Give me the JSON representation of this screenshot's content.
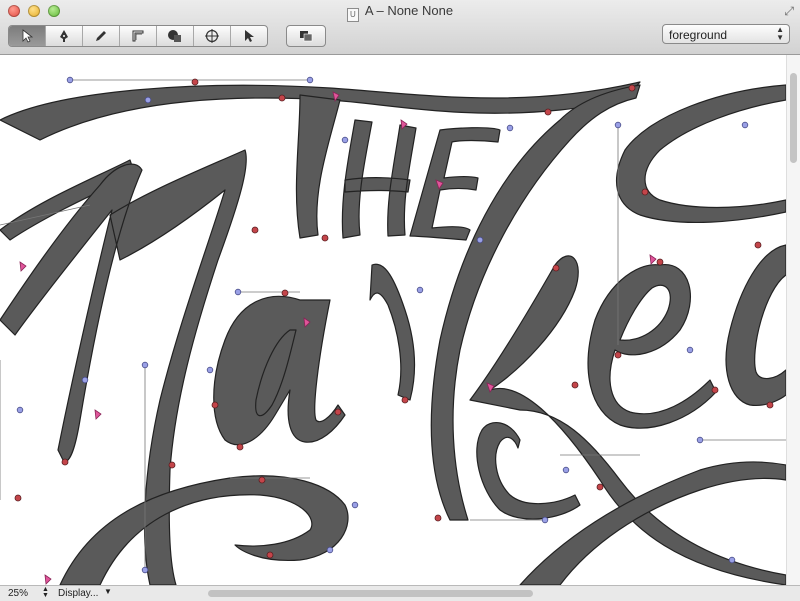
{
  "window": {
    "title": "A – None None",
    "doc_icon_glyph": "U"
  },
  "toolbar": {
    "tools": [
      {
        "name": "select-tool",
        "icon": "arrow-icon",
        "active": true
      },
      {
        "name": "pen-tool",
        "icon": "pen-nib-icon"
      },
      {
        "name": "draw-tool",
        "icon": "pencil-icon"
      },
      {
        "name": "measure-tool",
        "icon": "ruler-corner-icon"
      },
      {
        "name": "shapes-tool",
        "icon": "shapes-icon"
      },
      {
        "name": "knife-tool",
        "icon": "crosshair-icon"
      },
      {
        "name": "point-select-tool",
        "icon": "pointer-icon"
      }
    ],
    "solo_tool": {
      "name": "layers-toggle",
      "icon": "layers-icon"
    },
    "layer_select": {
      "value": "foreground"
    }
  },
  "status": {
    "zoom": "25%",
    "display": "Display..."
  },
  "colors": {
    "glyph_fill": "#5a5a5a",
    "on_curve_point": "#c4454a",
    "off_curve_point": "#9aa0e6",
    "selected_handle": "#e0559a"
  }
}
